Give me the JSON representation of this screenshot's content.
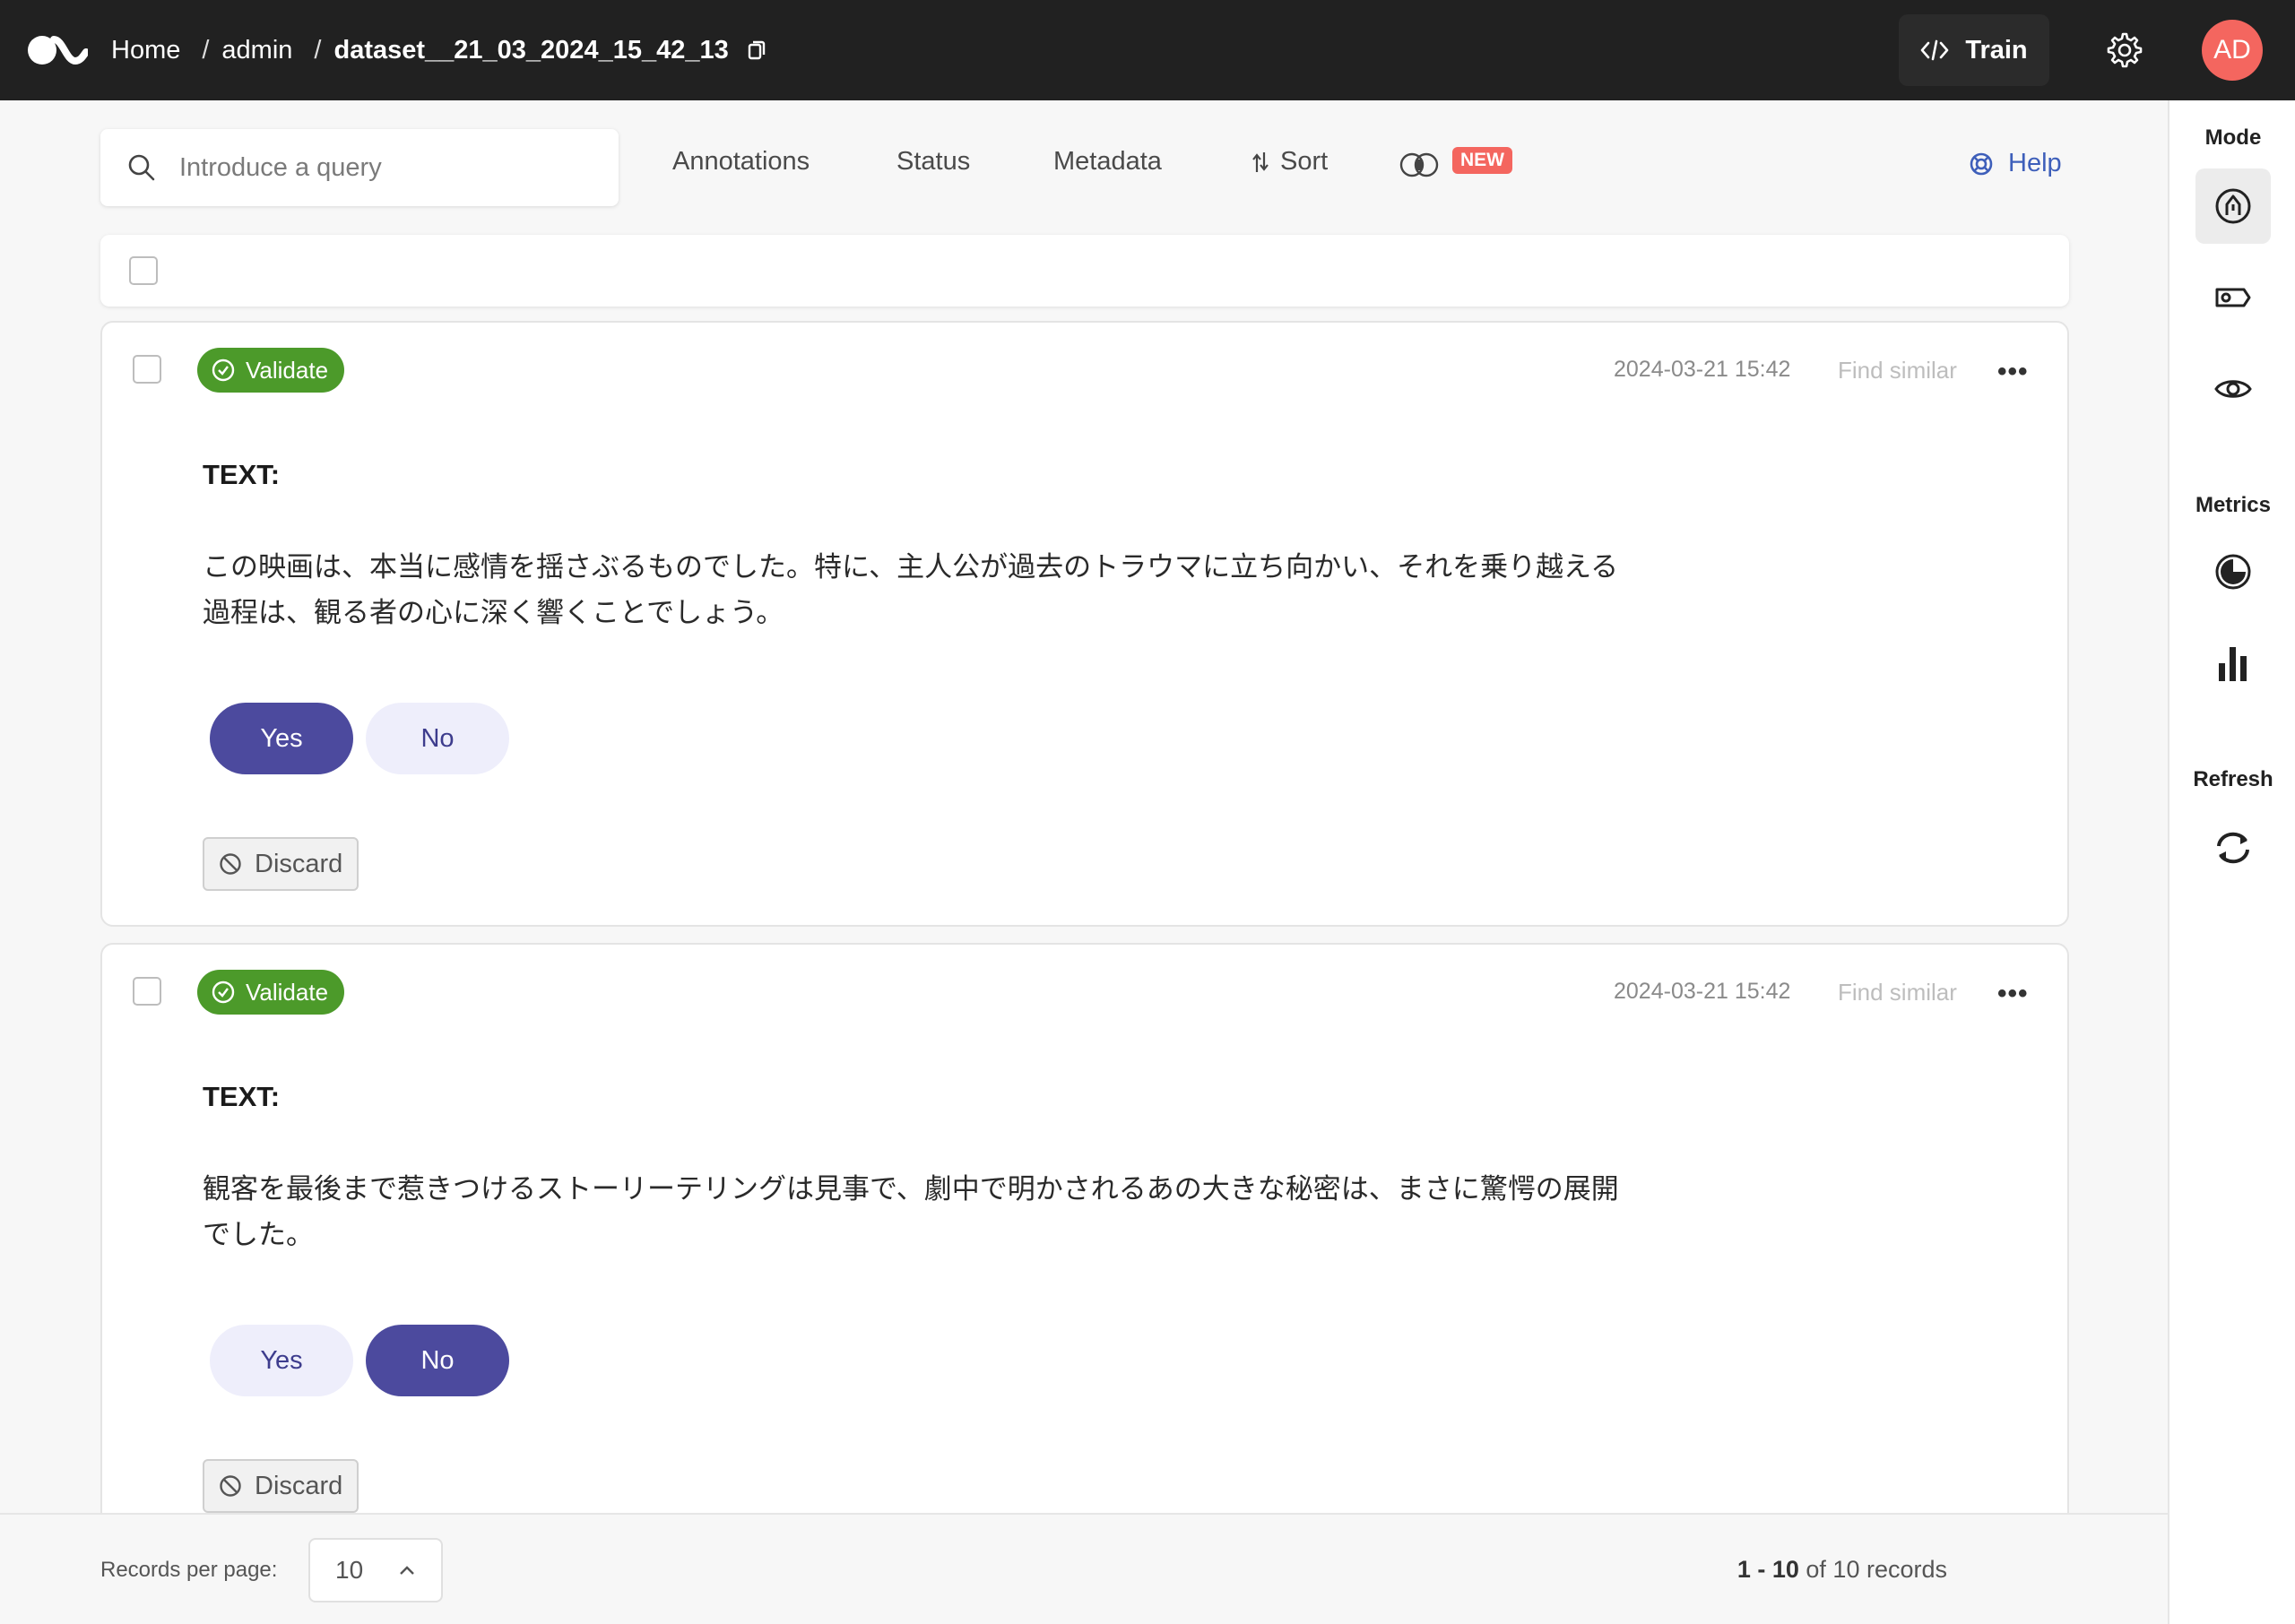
{
  "header": {
    "breadcrumb": [
      "Home",
      "admin",
      "dataset__21_03_2024_15_42_13"
    ],
    "train_label": "Train",
    "avatar_initials": "AD"
  },
  "toolbar": {
    "search_placeholder": "Introduce a query",
    "filters": [
      "Annotations",
      "Status",
      "Metadata"
    ],
    "sort_label": "Sort",
    "new_badge": "NEW",
    "help_label": "Help"
  },
  "sidebar": {
    "mode_title": "Mode",
    "metrics_title": "Metrics",
    "refresh_title": "Refresh",
    "mode_icons": [
      "annotate-mode-icon",
      "label-mode-icon",
      "review-mode-icon"
    ],
    "metrics_icons": [
      "progress-icon",
      "bar-chart-icon"
    ],
    "refresh_icon": "refresh-icon"
  },
  "records": [
    {
      "status": "Validate",
      "timestamp": "2024-03-21 15:42",
      "find_similar": "Find similar",
      "field_name": "TEXT:",
      "text": "この映画は、本当に感情を揺さぶるものでした。特に、主人公が過去のトラウマに立ち向かい、それを乗り越える過程は、観る者の心に深く響くことでしょう。",
      "options": [
        "Yes",
        "No"
      ],
      "selected": "Yes",
      "discard_label": "Discard"
    },
    {
      "status": "Validate",
      "timestamp": "2024-03-21 15:42",
      "find_similar": "Find similar",
      "field_name": "TEXT:",
      "text": "観客を最後まで惹きつけるストーリーテリングは見事で、劇中で明かされるあの大きな秘密は、まさに驚愕の展開でした。",
      "options": [
        "Yes",
        "No"
      ],
      "selected": "No",
      "discard_label": "Discard"
    }
  ],
  "footer": {
    "records_per_page_label": "Records per page:",
    "records_per_page_value": "10",
    "range": "1 - 10",
    "of_text": "of 10 records"
  },
  "colors": {
    "topbar": "#212121",
    "validate_green": "#4c9a2a",
    "selected_option": "#4c4a9e",
    "unselected_option": "#eeeefb",
    "avatar": "#f4665f",
    "help_link": "#3e5fba"
  }
}
